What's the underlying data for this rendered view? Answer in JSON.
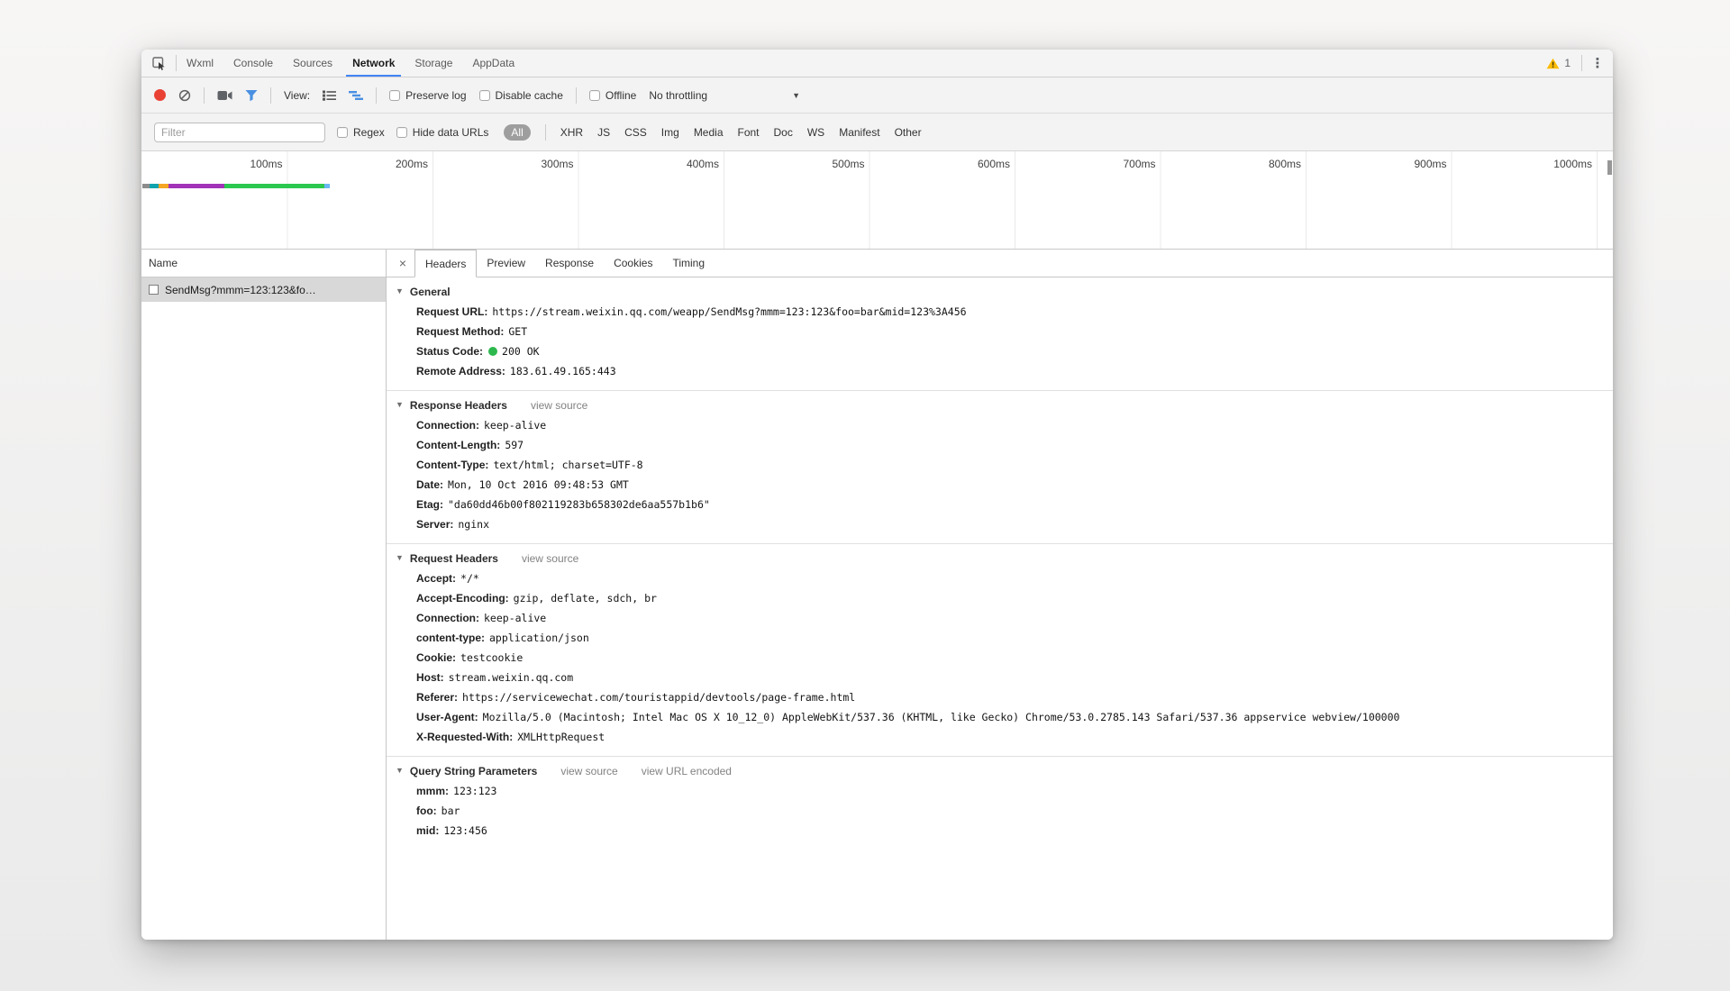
{
  "colors": {
    "accent_blue": "#4285f4",
    "record_red": "#e94235",
    "warning_yellow": "#fbbc04",
    "status_green": "#2db84d",
    "selected_row_gray": "#d8d8d8"
  },
  "tabbar": {
    "tabs": [
      "Wxml",
      "Console",
      "Sources",
      "Network",
      "Storage",
      "AppData"
    ],
    "active_tab": "Network",
    "warning_count": "1"
  },
  "toolbar": {
    "view_label": "View:",
    "preserve_log_label": "Preserve log",
    "disable_cache_label": "Disable cache",
    "offline_label": "Offline",
    "throttling_value": "No throttling"
  },
  "filterbar": {
    "filter_placeholder": "Filter",
    "regex_label": "Regex",
    "hide_data_urls_label": "Hide data URLs",
    "types": [
      "All",
      "XHR",
      "JS",
      "CSS",
      "Img",
      "Media",
      "Font",
      "Doc",
      "WS",
      "Manifest",
      "Other"
    ],
    "active_type": "All"
  },
  "timeline": {
    "labels": [
      "100ms",
      "200ms",
      "300ms",
      "400ms",
      "500ms",
      "600ms",
      "700ms",
      "800ms",
      "900ms",
      "1000ms"
    ],
    "tick_spacing_px": 161.5,
    "segments": [
      {
        "color": "#8c8c8c",
        "width": 8
      },
      {
        "color": "#0fa3ad",
        "width": 10
      },
      {
        "color": "#f5a623",
        "width": 11
      },
      {
        "color": "#a233b8",
        "width": 62
      },
      {
        "color": "#2bc850",
        "width": 111
      },
      {
        "color": "#6cb8f4",
        "width": 6
      }
    ]
  },
  "requests": {
    "name_header": "Name",
    "rows": [
      {
        "name": "SendMsg?mmm=123:123&fo…",
        "selected": true
      }
    ]
  },
  "details": {
    "close_label": "×",
    "tabs": [
      "Headers",
      "Preview",
      "Response",
      "Cookies",
      "Timing"
    ],
    "active_tab": "Headers",
    "sections": [
      {
        "title": "General",
        "links": [],
        "fields": [
          {
            "name": "Request URL:",
            "value": "https://stream.weixin.qq.com/weapp/SendMsg?mmm=123:123&foo=bar&mid=123%3A456"
          },
          {
            "name": "Request Method:",
            "value": "GET"
          },
          {
            "name": "Status Code:",
            "value": "200 OK",
            "status_dot": true
          },
          {
            "name": "Remote Address:",
            "value": "183.61.49.165:443"
          }
        ]
      },
      {
        "title": "Response Headers",
        "links": [
          "view source"
        ],
        "fields": [
          {
            "name": "Connection:",
            "value": "keep-alive"
          },
          {
            "name": "Content-Length:",
            "value": "597"
          },
          {
            "name": "Content-Type:",
            "value": "text/html; charset=UTF-8"
          },
          {
            "name": "Date:",
            "value": "Mon, 10 Oct 2016 09:48:53 GMT"
          },
          {
            "name": "Etag:",
            "value": "\"da60dd46b00f802119283b658302de6aa557b1b6\""
          },
          {
            "name": "Server:",
            "value": "nginx"
          }
        ]
      },
      {
        "title": "Request Headers",
        "links": [
          "view source"
        ],
        "fields": [
          {
            "name": "Accept:",
            "value": "*/*"
          },
          {
            "name": "Accept-Encoding:",
            "value": "gzip, deflate, sdch, br"
          },
          {
            "name": "Connection:",
            "value": "keep-alive"
          },
          {
            "name": "content-type:",
            "value": "application/json"
          },
          {
            "name": "Cookie:",
            "value": "testcookie"
          },
          {
            "name": "Host:",
            "value": "stream.weixin.qq.com"
          },
          {
            "name": "Referer:",
            "value": "https://servicewechat.com/touristappid/devtools/page-frame.html"
          },
          {
            "name": "User-Agent:",
            "value": "Mozilla/5.0 (Macintosh; Intel Mac OS X 10_12_0) AppleWebKit/537.36 (KHTML, like Gecko) Chrome/53.0.2785.143 Safari/537.36 appservice webview/100000"
          },
          {
            "name": "X-Requested-With:",
            "value": "XMLHttpRequest"
          }
        ]
      },
      {
        "title": "Query String Parameters",
        "links": [
          "view source",
          "view URL encoded"
        ],
        "fields": [
          {
            "name": "mmm:",
            "value": "123:123"
          },
          {
            "name": "foo:",
            "value": "bar"
          },
          {
            "name": "mid:",
            "value": "123:456"
          }
        ]
      }
    ]
  }
}
